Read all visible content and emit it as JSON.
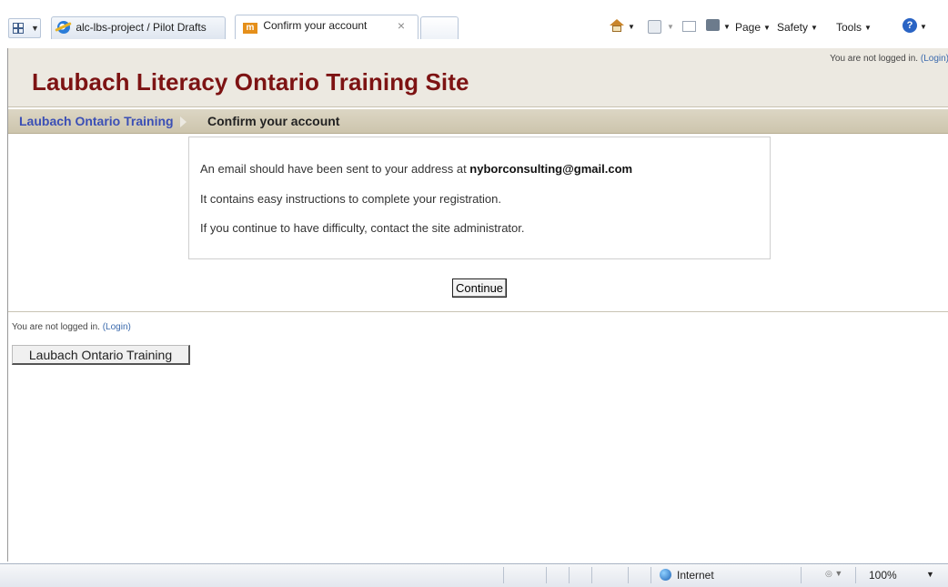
{
  "browser": {
    "tabs": [
      {
        "label": "alc-lbs-project / Pilot Drafts",
        "active": false
      },
      {
        "label": "Confirm your account",
        "active": true
      }
    ],
    "close_glyph": "×",
    "commands": {
      "page": "Page",
      "safety": "Safety",
      "tools": "Tools"
    },
    "icons": [
      "quick-tabs-icon",
      "home-icon",
      "feeds-icon",
      "read-mail-icon",
      "print-icon",
      "help-icon"
    ]
  },
  "header": {
    "site_title": "Laubach Literacy Ontario Training Site",
    "login_text": "You are not logged in. ",
    "login_link": "(Login)"
  },
  "navbar": {
    "home": "Laubach Ontario Training",
    "current": "Confirm your account"
  },
  "notice": {
    "line1_prefix": "An email should have been sent to your address at ",
    "email": "nyborconsulting@gmail.com",
    "line2": "It contains easy instructions to complete your registration.",
    "line3": "If you continue to have difficulty, contact the site administrator."
  },
  "continue_label": "Continue",
  "footer": {
    "login_text": "You are not logged in. ",
    "login_link": "(Login)",
    "home_button": "Laubach Ontario Training"
  },
  "statusbar": {
    "zone": "Internet",
    "zoom": "100%"
  },
  "colors": {
    "title": "#7d1313",
    "breadcrumb_link": "#3b4fb5",
    "header_bg": "#ece9e1",
    "navbar_bg": "#cdc5ad"
  }
}
